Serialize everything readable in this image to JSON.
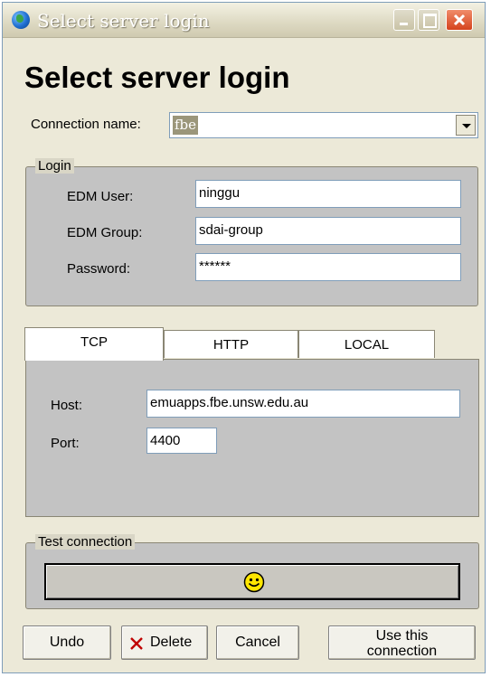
{
  "window": {
    "title": "Select server login",
    "heading": "Select server login"
  },
  "connection": {
    "label": "Connection name:",
    "value": "fbe"
  },
  "login": {
    "legend": "Login",
    "user_label": "EDM User:",
    "user_value": "ninggu",
    "group_label": "EDM Group:",
    "group_value": "sdai-group",
    "password_label": "Password:",
    "password_value": "******"
  },
  "tabs": [
    {
      "label": "TCP",
      "active": true
    },
    {
      "label": "HTTP",
      "active": false
    },
    {
      "label": "LOCAL",
      "active": false
    }
  ],
  "tcp": {
    "host_label": "Host:",
    "host_value": "emuapps.fbe.unsw.edu.au",
    "port_label": "Port:",
    "port_value": "4400"
  },
  "test": {
    "legend": "Test connection",
    "status_icon": "smiley-icon"
  },
  "buttons": {
    "undo": "Undo",
    "delete": "Delete",
    "cancel": "Cancel",
    "use_line1": "Use this",
    "use_line2": "connection"
  }
}
